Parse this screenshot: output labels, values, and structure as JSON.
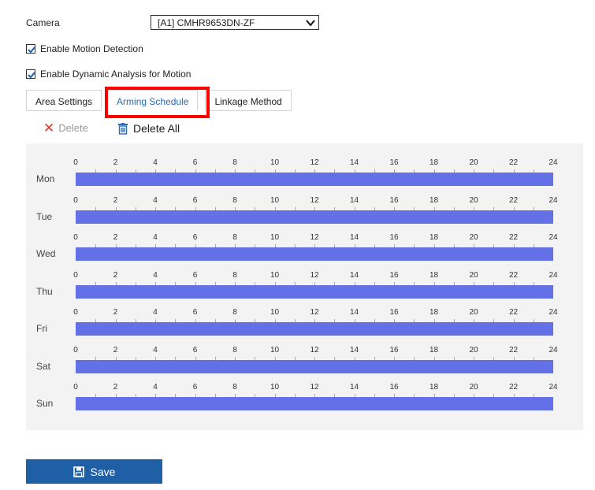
{
  "camera": {
    "label": "Camera",
    "selected": "[A1] CMHR9653DN-ZF"
  },
  "options": {
    "motion": {
      "label": "Enable Motion Detection",
      "checked": true
    },
    "dynamic": {
      "label": "Enable Dynamic Analysis for Motion",
      "checked": true
    }
  },
  "tabs": [
    {
      "label": "Area Settings",
      "active": false
    },
    {
      "label": "Arming Schedule",
      "active": true
    },
    {
      "label": "Linkage Method",
      "active": false
    }
  ],
  "toolbar": {
    "delete_label": "Delete",
    "delete_all_label": "Delete All"
  },
  "schedule": {
    "tick_labels": [
      "0",
      "2",
      "4",
      "6",
      "8",
      "10",
      "12",
      "14",
      "16",
      "18",
      "20",
      "22",
      "24"
    ],
    "days": [
      {
        "label": "Mon",
        "start": 0,
        "end": 24
      },
      {
        "label": "Tue",
        "start": 0,
        "end": 24
      },
      {
        "label": "Wed",
        "start": 0,
        "end": 24
      },
      {
        "label": "Thu",
        "start": 0,
        "end": 24
      },
      {
        "label": "Fri",
        "start": 0,
        "end": 24
      },
      {
        "label": "Sat",
        "start": 0,
        "end": 24
      },
      {
        "label": "Sun",
        "start": 0,
        "end": 24
      }
    ],
    "bar_color": "#6470e6"
  },
  "save": {
    "label": "Save"
  },
  "colors": {
    "accent": "#1f5fa6",
    "highlight": "#ff0000",
    "delete_icon": "#e2392b"
  }
}
